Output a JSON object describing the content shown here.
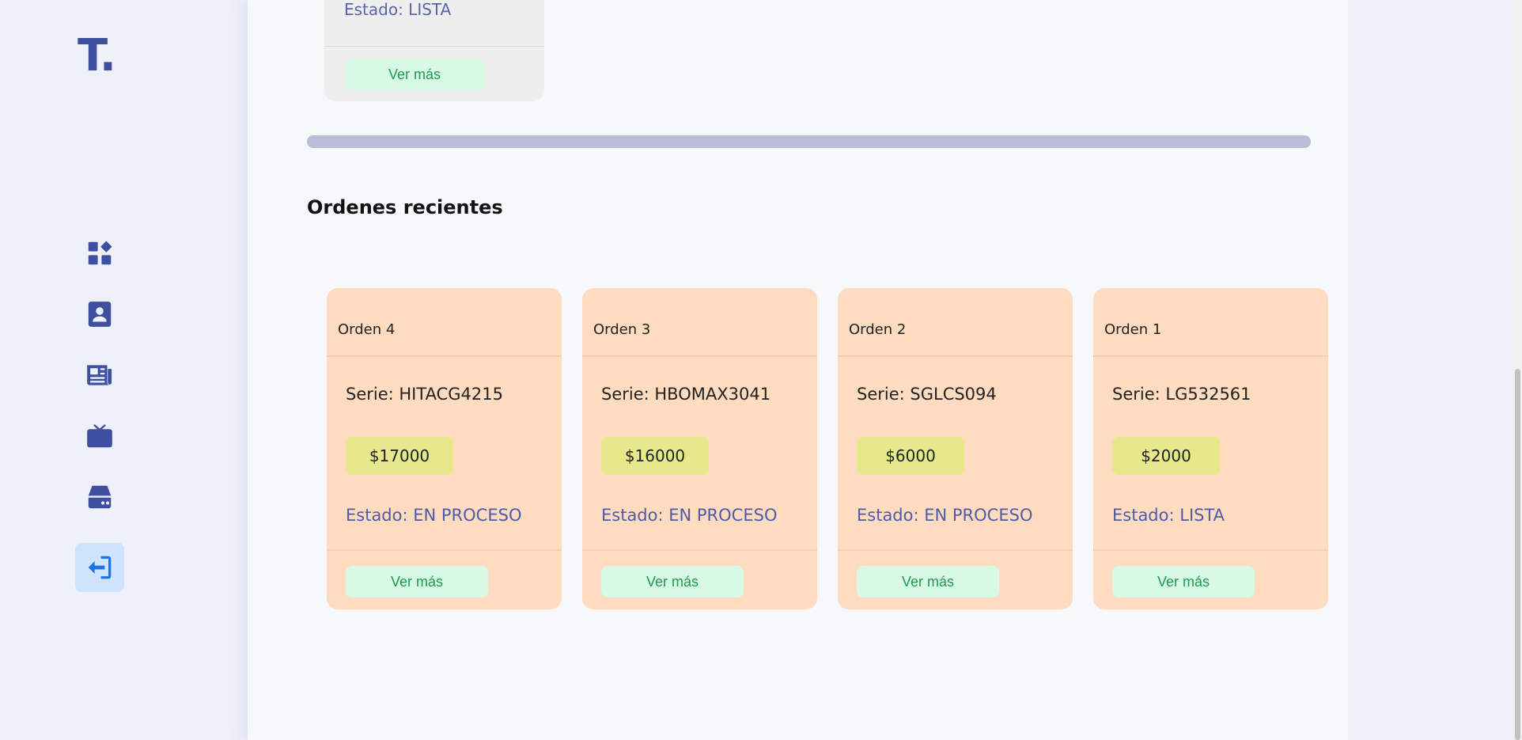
{
  "app": {
    "logo": "T."
  },
  "sidebar": {
    "items": [
      {
        "name": "dashboard",
        "icon": "dashboard-icon"
      },
      {
        "name": "contacts",
        "icon": "contact-card-icon"
      },
      {
        "name": "news",
        "icon": "newspaper-icon"
      },
      {
        "name": "tv",
        "icon": "tv-icon"
      },
      {
        "name": "storage",
        "icon": "hard-drive-icon"
      },
      {
        "name": "logout",
        "icon": "logout-icon",
        "active": true
      }
    ]
  },
  "previous_card": {
    "estado": "Estado: LISTA",
    "button": "Ver más"
  },
  "section_title": "Ordenes recientes",
  "orders": [
    {
      "title": "Orden 4",
      "serie": "Serie: HITACG4215",
      "price": "$17000",
      "estado": "Estado: EN PROCESO",
      "button": "Ver más"
    },
    {
      "title": "Orden 3",
      "serie": "Serie: HBOMAX3041",
      "price": "$16000",
      "estado": "Estado: EN PROCESO",
      "button": "Ver más"
    },
    {
      "title": "Orden 2",
      "serie": "Serie: SGLCS094",
      "price": "$6000",
      "estado": "Estado: EN PROCESO",
      "button": "Ver más"
    },
    {
      "title": "Orden 1",
      "serie": "Serie: LG532561",
      "price": "$2000",
      "estado": "Estado: LISTA",
      "button": "Ver más"
    }
  ],
  "colors": {
    "brand": "#3f4fa0",
    "card_bg": "#ffdcc0",
    "price_bg": "#e6e88a",
    "button_bg": "#d8f9e5",
    "button_text": "#1f9a4f",
    "active_nav": "#cfe3fd"
  }
}
